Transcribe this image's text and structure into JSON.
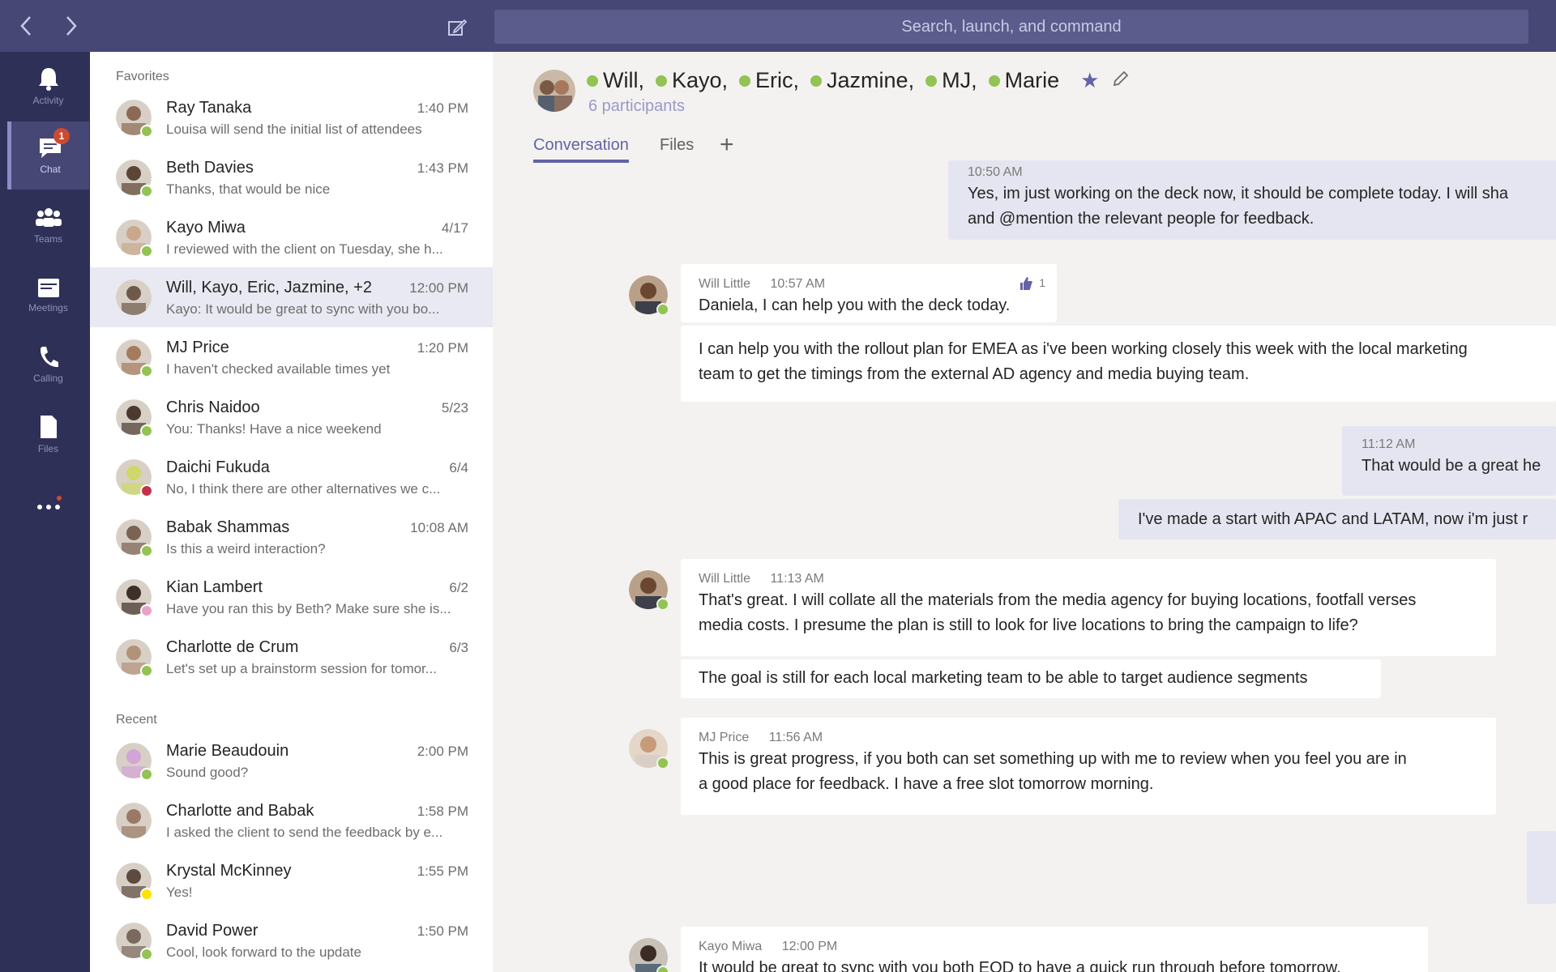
{
  "topbar": {
    "search_placeholder": "Search, launch, and command"
  },
  "rail": {
    "items": [
      {
        "label": "Activity",
        "icon": "bell-icon"
      },
      {
        "label": "Chat",
        "icon": "chat-icon",
        "badge": "1"
      },
      {
        "label": "Teams",
        "icon": "teams-icon"
      },
      {
        "label": "Meetings",
        "icon": "calendar-icon"
      },
      {
        "label": "Calling",
        "icon": "phone-icon"
      },
      {
        "label": "Files",
        "icon": "file-icon"
      }
    ]
  },
  "chatlist": {
    "favorites_label": "Favorites",
    "recent_label": "Recent",
    "favorites": [
      {
        "name": "Ray Tanaka",
        "time": "1:40 PM",
        "preview": "Louisa will send the initial list of attendees",
        "presence": "#92c353"
      },
      {
        "name": "Beth Davies",
        "time": "1:43 PM",
        "preview": "Thanks, that would be nice",
        "presence": "#92c353"
      },
      {
        "name": "Kayo Miwa",
        "time": "4/17",
        "preview": "I reviewed with the client on Tuesday, she h...",
        "presence": "#92c353"
      },
      {
        "name": "Will, Kayo, Eric, Jazmine, +2",
        "time": "12:00 PM",
        "preview": "Kayo: It would be great to sync with you bo...",
        "presence": ""
      },
      {
        "name": "MJ Price",
        "time": "1:20 PM",
        "preview": "I haven't checked available times yet",
        "presence": "#92c353"
      },
      {
        "name": "Chris Naidoo",
        "time": "5/23",
        "preview": "You: Thanks! Have a nice weekend",
        "presence": "#92c353"
      },
      {
        "name": "Daichi Fukuda",
        "time": "6/4",
        "preview": "No, I think there are other alternatives we c...",
        "presence": "#c4314b"
      },
      {
        "name": "Babak Shammas",
        "time": "10:08 AM",
        "preview": "Is this a weird interaction?",
        "presence": "#92c353"
      },
      {
        "name": "Kian Lambert",
        "time": "6/2",
        "preview": "Have you ran this by Beth? Make sure she is...",
        "presence": "#e8a2c7"
      },
      {
        "name": "Charlotte de Crum",
        "time": "6/3",
        "preview": "Let's set up a brainstorm session for tomor...",
        "presence": "#92c353"
      }
    ],
    "recent": [
      {
        "name": "Marie Beaudouin",
        "time": "2:00 PM",
        "preview": "Sound good?",
        "presence": "#92c353"
      },
      {
        "name": "Charlotte and Babak",
        "time": "1:58 PM",
        "preview": "I asked the client to send the feedback by e...",
        "presence": ""
      },
      {
        "name": "Krystal McKinney",
        "time": "1:55 PM",
        "preview": "Yes!",
        "presence": "#fde300"
      },
      {
        "name": "David Power",
        "time": "1:50 PM",
        "preview": "Cool, look forward to the update",
        "presence": "#92c353"
      }
    ]
  },
  "header": {
    "participants": [
      "Will,",
      "Kayo,",
      "Eric,",
      "Jazmine,",
      "MJ,",
      "Marie"
    ],
    "participant_count": "6 participants",
    "tabs": [
      "Conversation",
      "Files"
    ],
    "add_tab": "+"
  },
  "messages": [
    {
      "time": "10:50 AM",
      "text": "Yes, im just working on the deck now, it should be complete today. I will sha",
      "text2": "and @mention the relevant people for feedback."
    },
    {
      "sender": "Will Little",
      "time": "10:57 AM",
      "text": "Daniela, I can help you with the deck today.",
      "likes": "1"
    },
    {
      "text": "I can help you with the rollout plan for EMEA as i've been working closely this week with the local marketing",
      "text2": "team to get the timings from the external AD agency and media buying team."
    },
    {
      "time": "11:12 AM",
      "text": "That would be a great he"
    },
    {
      "text": "I've made a start with APAC and LATAM, now i'm just r"
    },
    {
      "sender": "Will Little",
      "time": "11:13 AM",
      "text": "That's great. I will collate all the materials from the media agency for buying locations, footfall verses",
      "text2": "media costs. I presume the plan is still to look for live locations to bring the campaign to life?"
    },
    {
      "text": "The goal is still for each local marketing team to be able to target audience segments"
    },
    {
      "sender": "MJ Price",
      "time": "11:56 AM",
      "text": "This is great progress, if you both can set something up with me to review when you feel you are in",
      "text2": "a good place for feedback. I have a free slot tomorrow morning."
    },
    {
      "sender": "Kayo Miwa",
      "time": "12:00 PM",
      "text": "It would be great to sync with you both EOD to have a quick run through before tomorrow."
    }
  ],
  "colors": {
    "accent": "#6264a7",
    "topbar": "#464775",
    "rail": "#2f3057",
    "online": "#92c353"
  }
}
